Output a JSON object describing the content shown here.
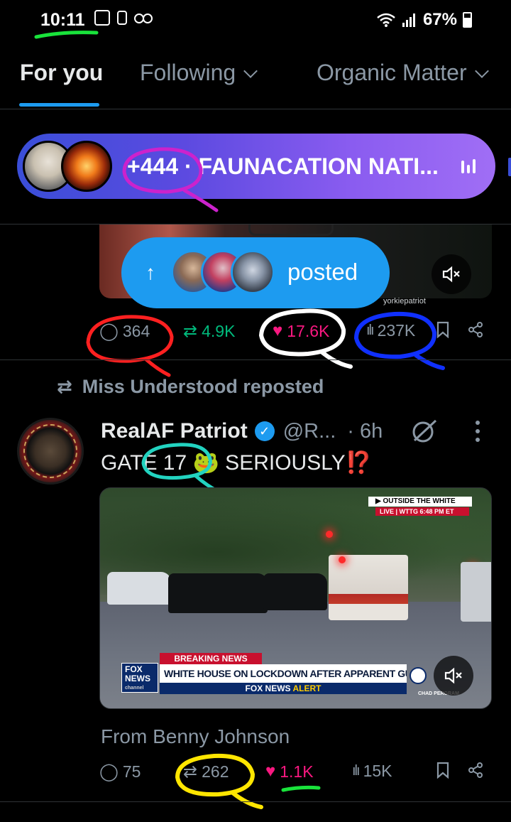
{
  "status_bar": {
    "time": "10:11",
    "battery": "67%"
  },
  "tabs": [
    {
      "label": "For you"
    },
    {
      "label": "Following"
    },
    {
      "label": "Organic Matter"
    }
  ],
  "space": {
    "text": "+444 · FAUNACATION NATI..."
  },
  "top_post": {
    "posted_label": "posted",
    "watermark": "yorkiepatriot",
    "replies": "364",
    "reposts": "4.9K",
    "likes": "17.6K",
    "views": "237K"
  },
  "repost_header": "Miss Understood reposted",
  "post": {
    "author": "RealAF Patriot",
    "handle": "@R...",
    "time": "· 6h",
    "text_main": "GATE 17 🐸 SERIOUSLY",
    "text_alert": "⁉️",
    "video": {
      "outside": "▶ OUTSIDE THE WHITE HOUSE",
      "live": "LIVE  |  WTTG  6:48 PM ET",
      "breaking": "BREAKING NEWS",
      "headline": "WHITE HOUSE ON LOCKDOWN AFTER APPARENT GUNSHOTS",
      "alert_prefix": "FOX NEWS",
      "alert_suffix": "ALERT",
      "fox_logo": "FOX NEWS",
      "fox_sub": "channel",
      "credit": "CHAD PERGRAM"
    },
    "from": "From Benny Johnson",
    "replies": "75",
    "reposts": "262",
    "likes": "1.1K",
    "views": "15K"
  },
  "colors": {
    "accent": "#1d9bf0",
    "retweet": "#00ba7c",
    "like": "#f91880",
    "muted": "#8b98a5"
  },
  "icons": [
    "reply-icon",
    "retweet-icon",
    "heart-icon",
    "views-icon",
    "bookmark-icon",
    "share-icon",
    "mute-icon",
    "grok-icon",
    "more-icon",
    "verified-icon"
  ]
}
